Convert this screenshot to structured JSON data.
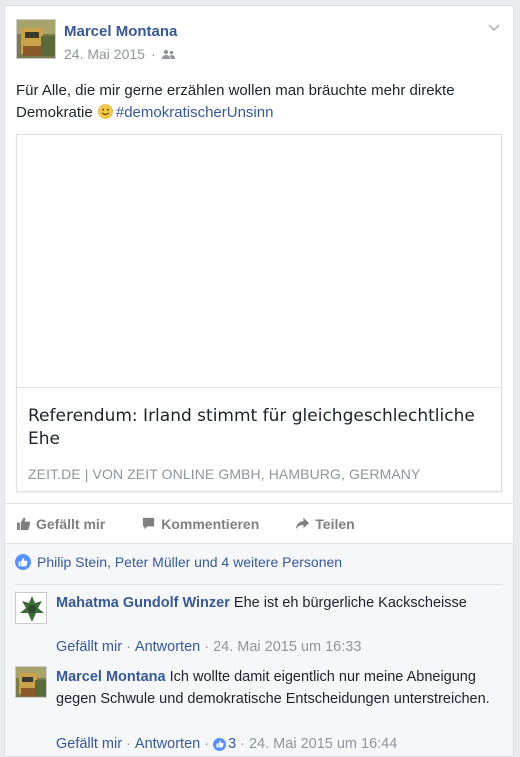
{
  "post": {
    "author": "Marcel Montana",
    "date": "24. Mai 2015",
    "audience_icon": "friends-icon",
    "text_main": "Für Alle, die mir gerne erzählen wollen man bräuchte mehr direkte Demokratie",
    "emoji": "smile-emoji",
    "hashtag": "#demokratischerUnsinn"
  },
  "link_preview": {
    "title": "Referendum: Irland stimmt für gleichgeschlechtliche Ehe",
    "source": "ZEIT.DE | VON ZEIT ONLINE GMBH, HAMBURG, GERMANY"
  },
  "actions": {
    "like": "Gefällt mir",
    "comment": "Kommentieren",
    "share": "Teilen"
  },
  "likes_summary": "Philip Stein, Peter Müller und 4 weitere Personen",
  "comments": [
    {
      "author": "Mahatma Gundolf Winzer",
      "text": "Ehe ist eh bürgerliche Kackscheisse",
      "like": "Gefällt mir",
      "reply": "Antworten",
      "time": "24. Mai 2015 um 16:33"
    },
    {
      "author": "Marcel Montana",
      "text": "Ich wollte damit eigentlich nur meine Abneigung gegen Schwule und demokratische Entscheidungen unterstreichen.",
      "like": "Gefällt mir",
      "reply": "Antworten",
      "reactions": "3",
      "time": "24. Mai 2015 um 16:44"
    }
  ],
  "colors": {
    "link_blue": "#365899",
    "meta_grey": "#90949c",
    "like_blue": "#5890ff"
  }
}
